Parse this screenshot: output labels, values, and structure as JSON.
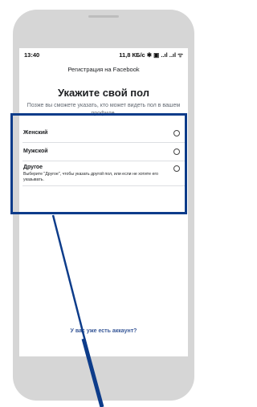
{
  "status_bar": {
    "time": "13:40",
    "indicators": "11,8 КБ/с ✱ ▣ ..ıl ..ıl ᯤ"
  },
  "app_bar": {
    "title": "Регистрация на Facebook"
  },
  "page": {
    "heading": "Укажите свой пол",
    "subtitle": "Позже вы сможете указать, кто может видеть пол в вашем профиле."
  },
  "options": [
    {
      "label": "Женский",
      "description": ""
    },
    {
      "label": "Мужской",
      "description": ""
    },
    {
      "label": "Другое",
      "description": "Выберите \"Другое\", чтобы указать другой пол, или если не хотите его указывать."
    }
  ],
  "footer": {
    "login_link": "У вас уже есть аккаунт?"
  },
  "colors": {
    "highlight_border": "#0d3c8a",
    "pointer_line": "#0d3c8a",
    "link": "#385898",
    "frame": "#d6d6d6"
  },
  "icons": [
    "radio-unselected-icon",
    "bluetooth-icon",
    "wifi-icon",
    "signal-icon"
  ]
}
